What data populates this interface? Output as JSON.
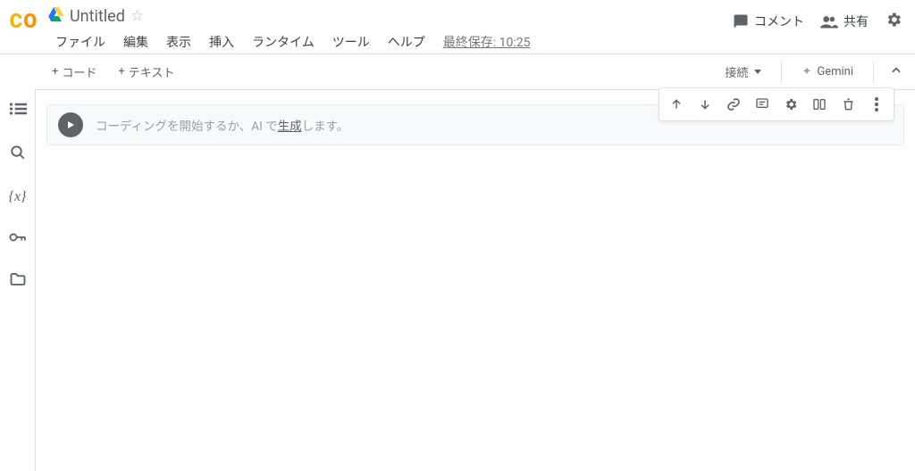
{
  "header": {
    "doc_title": "Untitled",
    "menus": {
      "file": "ファイル",
      "edit": "編集",
      "view": "表示",
      "insert": "挿入",
      "runtime": "ランタイム",
      "tools": "ツール",
      "help": "ヘルプ"
    },
    "last_saved": "最終保存: 10:25",
    "actions": {
      "comment": "コメント",
      "share": "共有"
    }
  },
  "toolbar": {
    "add_code": "コード",
    "add_text": "テキスト",
    "connect": "接続",
    "gemini": "Gemini"
  },
  "cell": {
    "placeholder_pre": "コーディングを開始するか、AI で",
    "placeholder_link": "生成",
    "placeholder_post": "します。"
  }
}
